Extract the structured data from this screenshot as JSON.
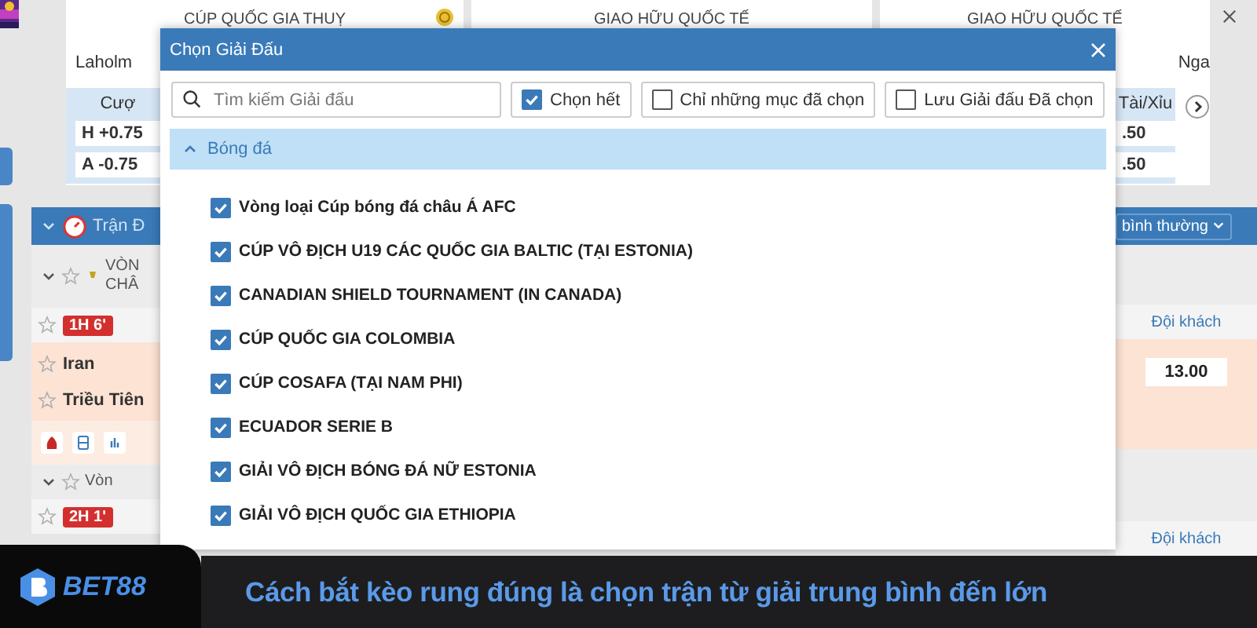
{
  "top_cards": [
    {
      "title": "CÚP QUỐC GIA THUỴ"
    },
    {
      "title": "GIAO HỮU QUỐC TẾ"
    },
    {
      "title": "GIAO HỮU QUỐC TẾ"
    }
  ],
  "left": {
    "team": "Laholm",
    "bet_header": "Cượ",
    "lines": [
      "H +0.75",
      "A -0.75"
    ],
    "match_header": "Trận Đ",
    "league_1": [
      "VÒN",
      "CHÂ"
    ],
    "badge_1": "1H 6'",
    "teams": [
      "Iran",
      "Triều Tiên"
    ],
    "league_2": "Vòn",
    "badge_2": "2H 1'"
  },
  "right": {
    "team": "Nga",
    "bet_header": "Tài/Xỉu",
    "lines": [
      ".50",
      ".50"
    ],
    "sort": "bình thường",
    "away_1": "Đội khách",
    "odds": "13.00",
    "away_2": "Đội khách"
  },
  "dialog": {
    "title": "Chọn Giải Đấu",
    "search": {
      "placeholder": "Tìm kiếm Giải đấu"
    },
    "options": [
      {
        "label": "Chọn hết",
        "checked": true
      },
      {
        "label": "Chỉ những mục đã chọn",
        "checked": false
      },
      {
        "label": "Lưu Giải đấu Đã chọn",
        "checked": false
      }
    ],
    "section": {
      "label": "Bóng đá",
      "expanded": true
    },
    "leagues": [
      {
        "label": "Vòng loại Cúp bóng đá châu Á AFC",
        "checked": true
      },
      {
        "label": "CÚP VÔ ĐỊCH U19 CÁC QUỐC GIA BALTIC (TẠI ESTONIA)",
        "checked": true
      },
      {
        "label": "CANADIAN SHIELD TOURNAMENT (IN CANADA)",
        "checked": true
      },
      {
        "label": "CÚP QUỐC GIA COLOMBIA",
        "checked": true
      },
      {
        "label": "CÚP COSAFA (TẠI NAM PHI)",
        "checked": true
      },
      {
        "label": "ECUADOR SERIE B",
        "checked": true
      },
      {
        "label": "GIẢI VÔ ĐỊCH BÓNG ĐÁ NỮ ESTONIA",
        "checked": true
      },
      {
        "label": "GIẢI VÔ ĐỊCH QUỐC GIA ETHIOPIA",
        "checked": true
      }
    ]
  },
  "banner": {
    "logo": "BET88",
    "caption": "Cách bắt kèo rung đúng là chọn trận từ giải trung bình đến lớn"
  }
}
